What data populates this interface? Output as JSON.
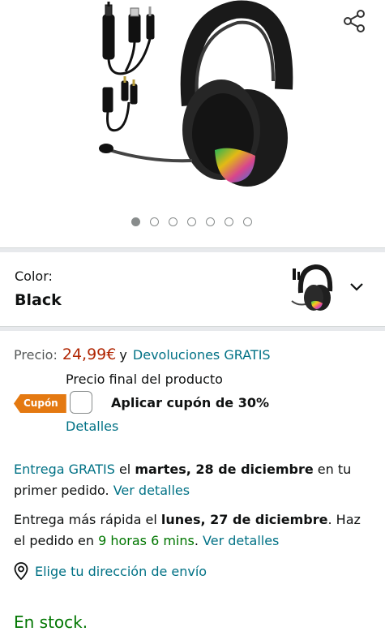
{
  "gallery": {
    "image_alt": "Auriculares gaming negros con micrófono e iluminación RGB",
    "dot_count": 7,
    "active_dot": 0,
    "share_icon": "share-icon"
  },
  "color": {
    "label": "Color:",
    "value": "Black"
  },
  "price": {
    "label": "Precio:",
    "amount": "24,99€",
    "conjunction": "y",
    "returns_link": "Devoluciones GRATIS",
    "final_note": "Precio final del producto"
  },
  "coupon": {
    "badge": "Cupón",
    "text": "Aplicar cupón de 30%",
    "details_link": "Detalles",
    "checked": false
  },
  "delivery": {
    "free_link": "Entrega GRATIS",
    "free_mid": " el ",
    "free_date": "martes, 28 de diciembre",
    "free_tail": " en tu primer pedido. ",
    "free_details": "Ver detalles",
    "fast_prefix": "Entrega más rápida el ",
    "fast_date": "lunes, 27 de diciembre",
    "fast_mid": ". Haz el pedido en ",
    "fast_time": "9 horas 6 mins",
    "fast_dot": ". ",
    "fast_details": "Ver detalles"
  },
  "location": {
    "icon": "location-pin-icon",
    "text": "Elige tu dirección de envío"
  },
  "stock": {
    "text": "En stock."
  },
  "colors": {
    "link": "#007185",
    "price": "#b12704",
    "green": "#007600",
    "coupon_badge": "#e47911"
  }
}
